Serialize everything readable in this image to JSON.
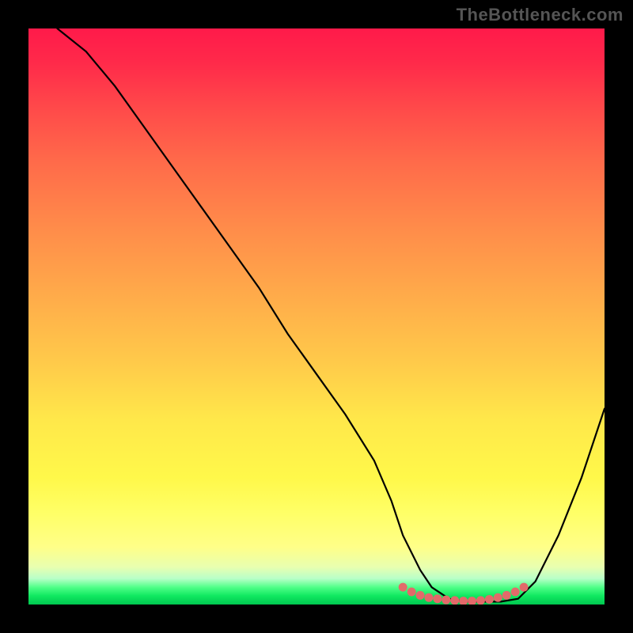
{
  "watermark": "TheBottleneck.com",
  "chart_data": {
    "type": "line",
    "title": "",
    "xlabel": "",
    "ylabel": "",
    "xlim": [
      0,
      100
    ],
    "ylim": [
      0,
      100
    ],
    "background_gradient": {
      "stops": [
        {
          "pos": 0,
          "color": "#ff1a4a"
        },
        {
          "pos": 50,
          "color": "#ffca4a"
        },
        {
          "pos": 85,
          "color": "#ffff66"
        },
        {
          "pos": 100,
          "color": "#00c850"
        }
      ]
    },
    "series": [
      {
        "name": "bottleneck-curve",
        "color": "#000000",
        "x": [
          5,
          10,
          15,
          20,
          25,
          30,
          35,
          40,
          45,
          50,
          55,
          60,
          63,
          65,
          68,
          70,
          73,
          76,
          79,
          82,
          85,
          88,
          92,
          96,
          100
        ],
        "y": [
          100,
          96,
          90,
          83,
          76,
          69,
          62,
          55,
          47,
          40,
          33,
          25,
          18,
          12,
          6,
          3,
          1,
          0.5,
          0.5,
          0.5,
          1,
          4,
          12,
          22,
          34
        ]
      }
    ],
    "markers": {
      "name": "optimal-range",
      "color": "#e26a6a",
      "x": [
        65,
        66.5,
        68,
        69.5,
        71,
        72.5,
        74,
        75.5,
        77,
        78.5,
        80,
        81.5,
        83,
        84.5,
        86
      ],
      "y": [
        3,
        2.2,
        1.6,
        1.2,
        1,
        0.8,
        0.7,
        0.6,
        0.6,
        0.7,
        0.9,
        1.2,
        1.6,
        2.2,
        3
      ]
    }
  }
}
